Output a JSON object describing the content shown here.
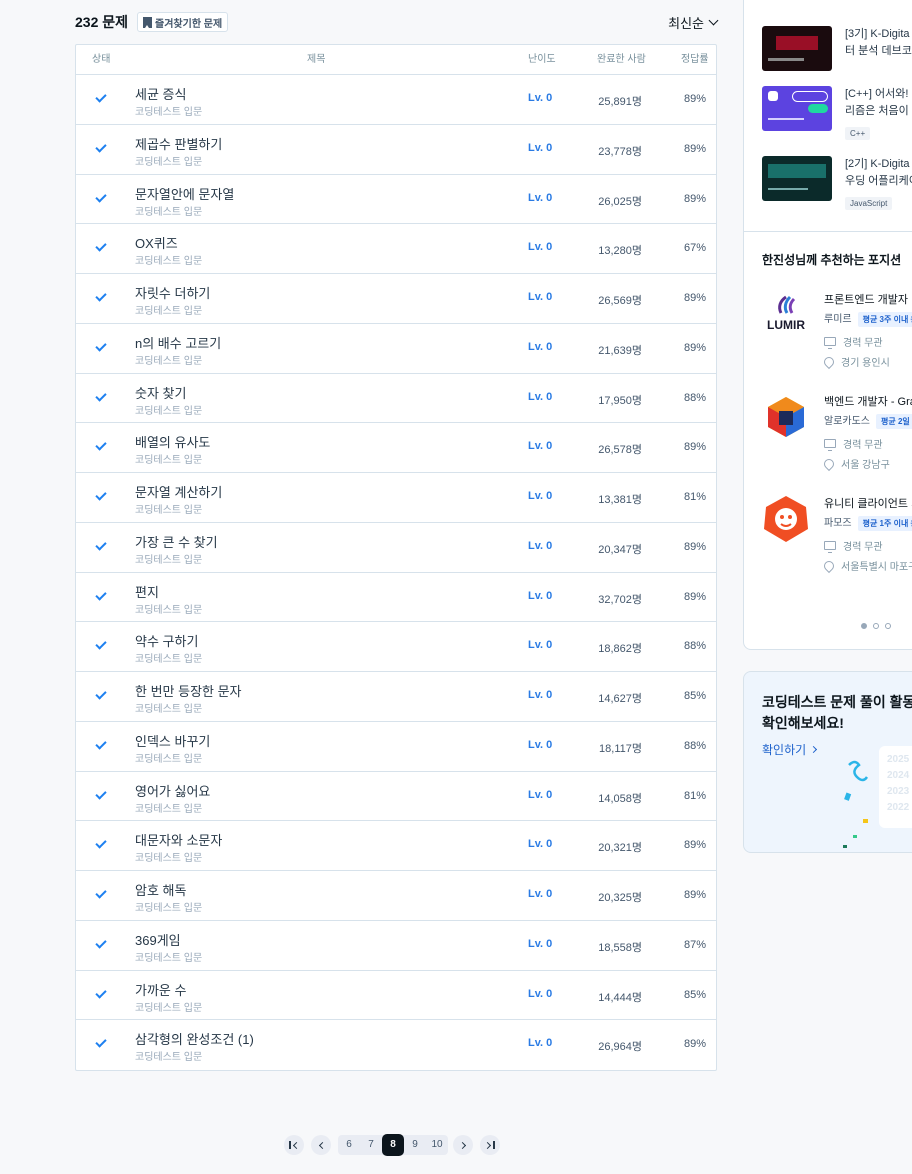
{
  "list": {
    "count": "232 문제",
    "favorites_label": "즐겨찾기한 문제",
    "sort_label": "최신순",
    "headers": {
      "status": "상태",
      "title": "제목",
      "level": "난이도",
      "done": "완료한 사람",
      "rate": "정답률"
    },
    "rows": [
      {
        "title": "세균 증식",
        "part": "코딩테스트 입문",
        "level": "Lv. 0",
        "done": "25,891명",
        "rate": "89%"
      },
      {
        "title": "제곱수 판별하기",
        "part": "코딩테스트 입문",
        "level": "Lv. 0",
        "done": "23,778명",
        "rate": "89%"
      },
      {
        "title": "문자열안에 문자열",
        "part": "코딩테스트 입문",
        "level": "Lv. 0",
        "done": "26,025명",
        "rate": "89%"
      },
      {
        "title": "OX퀴즈",
        "part": "코딩테스트 입문",
        "level": "Lv. 0",
        "done": "13,280명",
        "rate": "67%"
      },
      {
        "title": "자릿수 더하기",
        "part": "코딩테스트 입문",
        "level": "Lv. 0",
        "done": "26,569명",
        "rate": "89%"
      },
      {
        "title": "n의 배수 고르기",
        "part": "코딩테스트 입문",
        "level": "Lv. 0",
        "done": "21,639명",
        "rate": "89%"
      },
      {
        "title": "숫자 찾기",
        "part": "코딩테스트 입문",
        "level": "Lv. 0",
        "done": "17,950명",
        "rate": "88%"
      },
      {
        "title": "배열의 유사도",
        "part": "코딩테스트 입문",
        "level": "Lv. 0",
        "done": "26,578명",
        "rate": "89%"
      },
      {
        "title": "문자열 계산하기",
        "part": "코딩테스트 입문",
        "level": "Lv. 0",
        "done": "13,381명",
        "rate": "81%"
      },
      {
        "title": "가장 큰 수 찾기",
        "part": "코딩테스트 입문",
        "level": "Lv. 0",
        "done": "20,347명",
        "rate": "89%"
      },
      {
        "title": "편지",
        "part": "코딩테스트 입문",
        "level": "Lv. 0",
        "done": "32,702명",
        "rate": "89%"
      },
      {
        "title": "약수 구하기",
        "part": "코딩테스트 입문",
        "level": "Lv. 0",
        "done": "18,862명",
        "rate": "88%"
      },
      {
        "title": "한 번만 등장한 문자",
        "part": "코딩테스트 입문",
        "level": "Lv. 0",
        "done": "14,627명",
        "rate": "85%"
      },
      {
        "title": "인덱스 바꾸기",
        "part": "코딩테스트 입문",
        "level": "Lv. 0",
        "done": "18,117명",
        "rate": "88%"
      },
      {
        "title": "영어가 싫어요",
        "part": "코딩테스트 입문",
        "level": "Lv. 0",
        "done": "14,058명",
        "rate": "81%"
      },
      {
        "title": "대문자와 소문자",
        "part": "코딩테스트 입문",
        "level": "Lv. 0",
        "done": "20,321명",
        "rate": "89%"
      },
      {
        "title": "암호 해독",
        "part": "코딩테스트 입문",
        "level": "Lv. 0",
        "done": "20,325명",
        "rate": "89%"
      },
      {
        "title": "369게임",
        "part": "코딩테스트 입문",
        "level": "Lv. 0",
        "done": "18,558명",
        "rate": "87%"
      },
      {
        "title": "가까운 수",
        "part": "코딩테스트 입문",
        "level": "Lv. 0",
        "done": "14,444명",
        "rate": "85%"
      },
      {
        "title": "삼각형의 완성조건 (1)",
        "part": "코딩테스트 입문",
        "level": "Lv. 0",
        "done": "26,964명",
        "rate": "89%"
      }
    ]
  },
  "pagination": {
    "pages": [
      "6",
      "7",
      "8",
      "9",
      "10"
    ],
    "current": "8"
  },
  "sidebar": {
    "courses": [
      {
        "line1": "[3기] K-Digita",
        "line2": "터 분석 데브코",
        "tag": ""
      },
      {
        "line1": "[C++] 어서와!",
        "line2": "리즘은 처음이",
        "tag": "C++"
      },
      {
        "line1": "[2기] K-Digita",
        "line2": "우딩 어플리케이",
        "tag": "JavaScript"
      }
    ],
    "rec_title": "한진성님께 추천하는 포지션",
    "jobs": [
      {
        "title": "프론트엔드 개발자",
        "company": "루미르",
        "badge": "평균 3주 이내 응",
        "career": "경력 무관",
        "location": "경기 용인시"
      },
      {
        "title": "백엔드 개발자 - Gra",
        "company": "알로카도스",
        "badge": "평균 2일 이",
        "career": "경력 무관",
        "location": "서울 강남구"
      },
      {
        "title": "유니티 클라이언트 개",
        "company": "파모즈",
        "badge": "평균 1주 이내 응",
        "career": "경력 무관",
        "location": "서울특별시 마포구"
      }
    ],
    "lumir_logo": "LUMIR",
    "promo_title_1": "코딩테스트 문제 풀이 활동",
    "promo_title_2": "확인해보세요!",
    "promo_link": "확인하기",
    "promo_years": [
      "2025",
      "2024",
      "2023",
      "2022"
    ]
  }
}
